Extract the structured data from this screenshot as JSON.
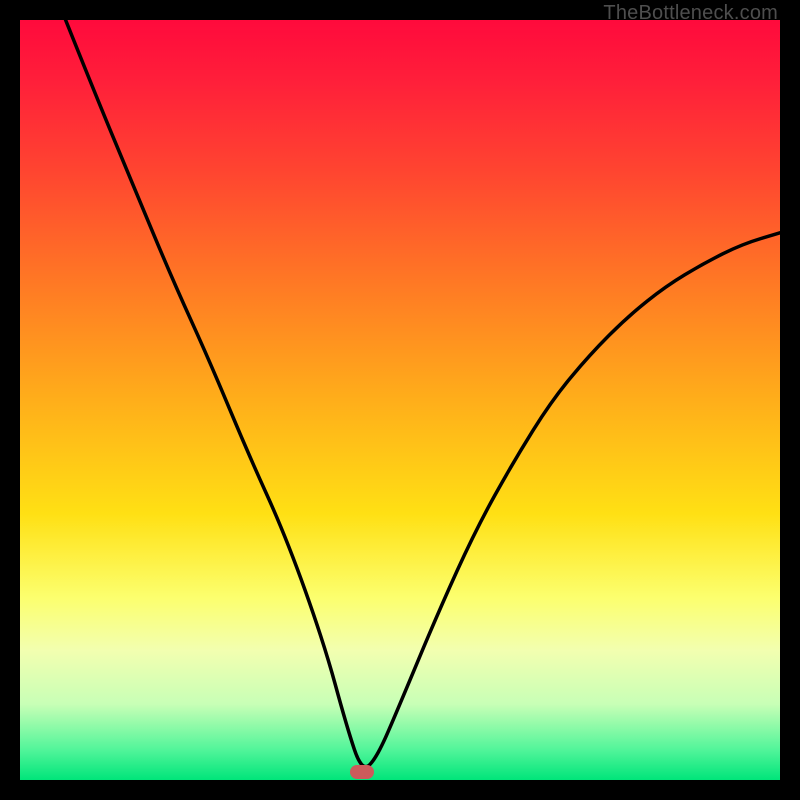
{
  "watermark": "TheBottleneck.com",
  "chart_data": {
    "type": "line",
    "title": "",
    "xlabel": "",
    "ylabel": "",
    "xlim": [
      0,
      100
    ],
    "ylim": [
      0,
      100
    ],
    "annotations": [
      {
        "kind": "marker",
        "x": 45,
        "y": 1,
        "color": "#cc5b5b"
      }
    ],
    "series": [
      {
        "name": "curve",
        "x": [
          6,
          10,
          15,
          20,
          25,
          30,
          35,
          40,
          43,
          45,
          47,
          50,
          55,
          60,
          65,
          70,
          75,
          80,
          85,
          90,
          95,
          100
        ],
        "values": [
          100,
          90,
          78,
          66,
          55,
          43,
          32,
          18,
          7,
          1,
          3,
          10,
          22,
          33,
          42,
          50,
          56,
          61,
          65,
          68,
          70.5,
          72
        ]
      }
    ],
    "background_gradient": {
      "direction": "vertical",
      "stops": [
        {
          "pos": 0,
          "color": "#ff0a3c"
        },
        {
          "pos": 50,
          "color": "#ffae1a"
        },
        {
          "pos": 76,
          "color": "#fcff6e"
        },
        {
          "pos": 100,
          "color": "#00e57a"
        }
      ]
    }
  }
}
